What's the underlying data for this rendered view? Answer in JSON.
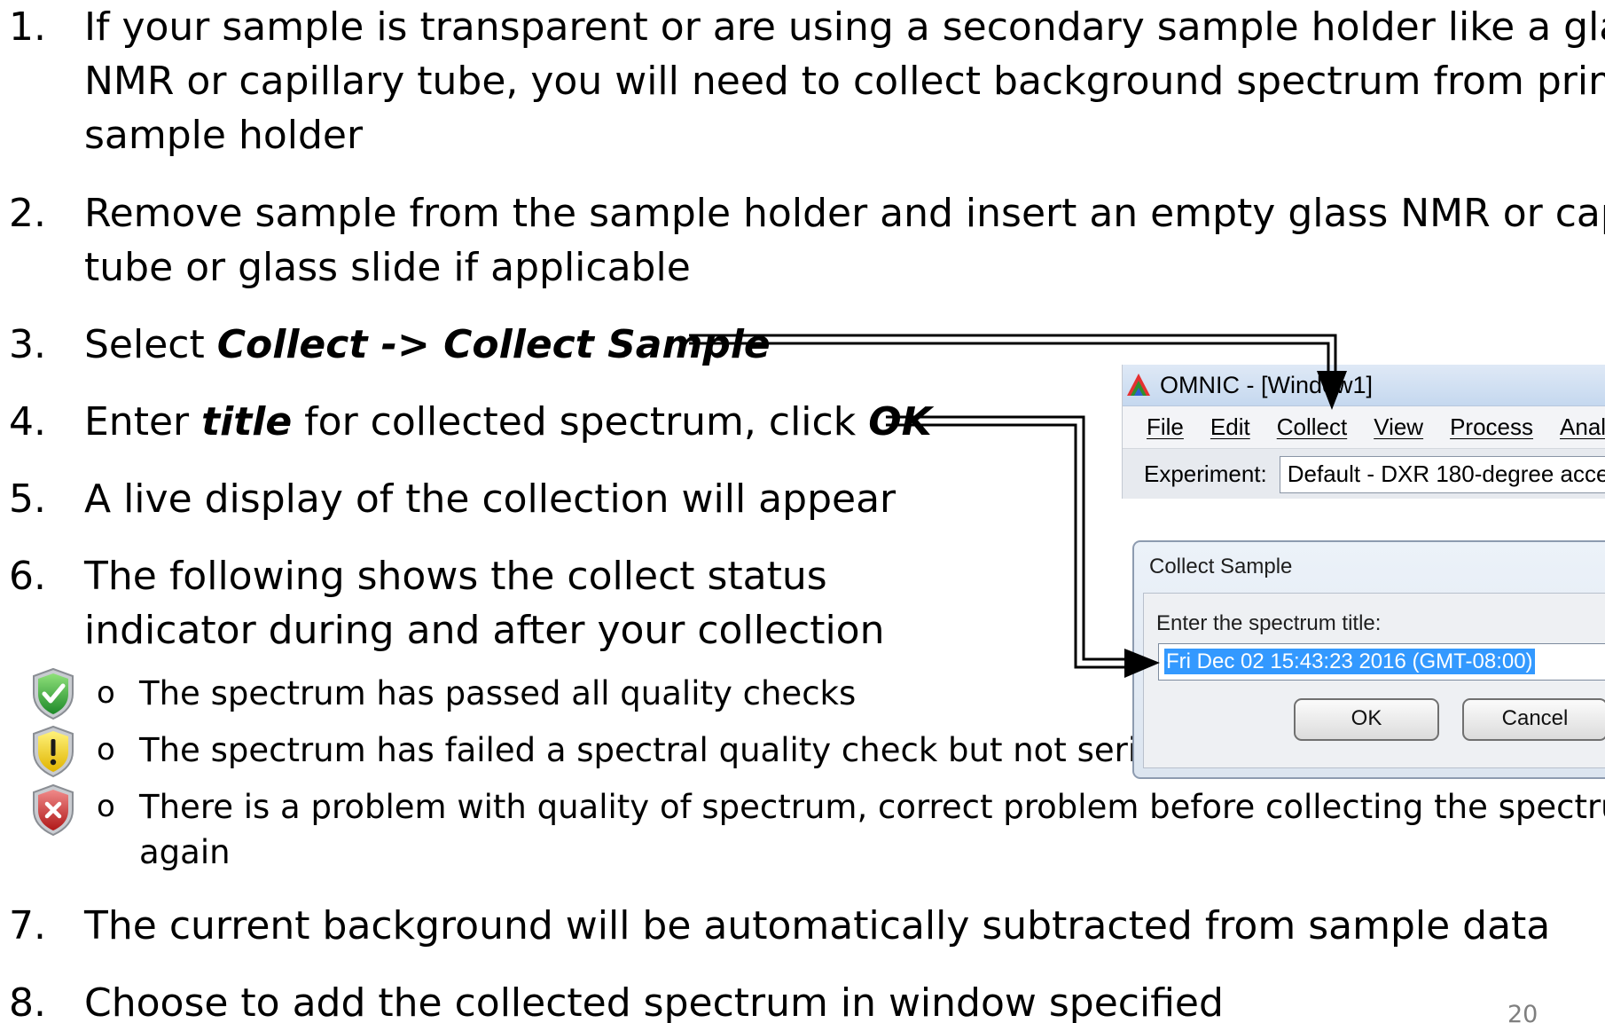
{
  "instructions": [
    {
      "num": "1.",
      "lines": [
        "If your sample is transparent or are using a secondary sample holder like a glass",
        "NMR or capillary tube, you will need to collect background spectrum from primary",
        "sample holder"
      ]
    },
    {
      "num": "2.",
      "lines": [
        "Remove sample from the sample holder and insert an empty glass NMR or capillary",
        "tube or glass slide if applicable"
      ]
    },
    {
      "num": "3.",
      "prefix": "Select ",
      "emphasis": "Collect -> Collect Sample"
    },
    {
      "num": "4.",
      "prefix": "Enter ",
      "emphasis1": "title",
      "middle": " for collected spectrum, click ",
      "emphasis2": "OK"
    },
    {
      "num": "5.",
      "text": "A live display of the collection will appear"
    },
    {
      "num": "6.",
      "lines": [
        "The following shows the collect status",
        "indicator during and after your collection"
      ]
    },
    {
      "num": "7.",
      "text": "The current background will be automatically subtracted from sample data"
    },
    {
      "num": "8.",
      "text": "Choose to add the collected spectrum in window specified"
    }
  ],
  "status_indicators": [
    {
      "icon": "green-check-shield-icon",
      "bullet": "o",
      "lines": [
        "The spectrum has passed all quality checks"
      ]
    },
    {
      "icon": "yellow-warning-shield-icon",
      "bullet": "o",
      "lines": [
        "The spectrum has failed a spectral quality check but not serious"
      ]
    },
    {
      "icon": "red-error-shield-icon",
      "bullet": "o",
      "lines": [
        "There is a problem with quality of spectrum, correct problem before collecting the spectrum",
        "again"
      ]
    }
  ],
  "omnic_window": {
    "title": "OMNIC - [Window1]",
    "menu": [
      "File",
      "Edit",
      "Collect",
      "View",
      "Process",
      "Anal"
    ],
    "experiment_label": "Experiment:",
    "experiment_value": "Default - DXR 180-degree acce"
  },
  "collect_dialog": {
    "title": "Collect Sample",
    "prompt": "Enter the spectrum title:",
    "input_value": "Fri Dec 02 15:43:23 2016 (GMT-08:00)",
    "ok_label": "OK",
    "cancel_label": "Cancel"
  },
  "page_number": "20",
  "colors": {
    "selection": "#3399ff",
    "page_number": "#7f7f7f"
  }
}
